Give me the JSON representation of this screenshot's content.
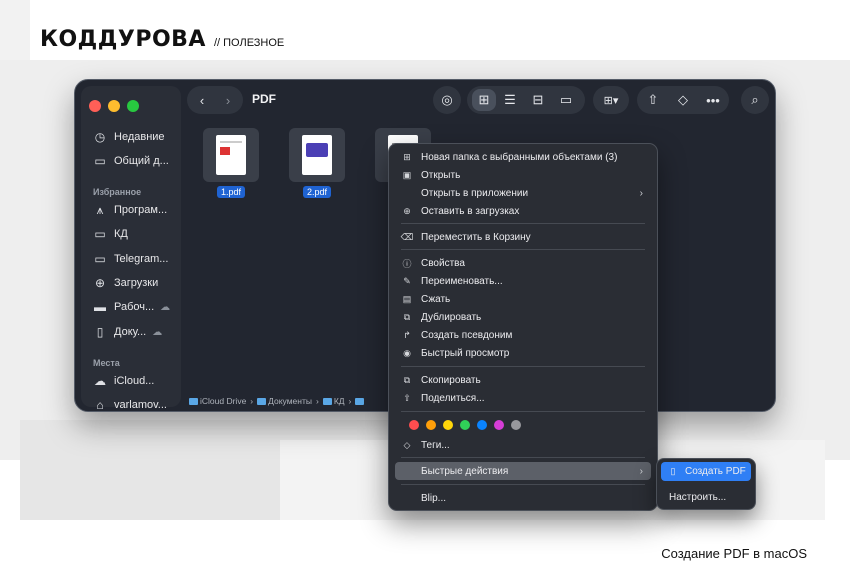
{
  "brand": {
    "logo": "КОДДУРОВА",
    "tag": "// ПОЛЕЗНОЕ"
  },
  "caption": "Создание PDF в macOS",
  "window": {
    "title": "PDF"
  },
  "sidebar": {
    "items_top": [
      {
        "icon": "clock-icon",
        "label": "Недавние"
      },
      {
        "icon": "shared-folder-icon",
        "label": "Общий д..."
      }
    ],
    "favorites_header": "Избранное",
    "favorites": [
      {
        "icon": "applications-icon",
        "label": "Програм..."
      },
      {
        "icon": "folder-icon",
        "label": "КД"
      },
      {
        "icon": "folder-icon",
        "label": "Telegram..."
      },
      {
        "icon": "downloads-icon",
        "label": "Загрузки"
      },
      {
        "icon": "desktop-icon",
        "label": "Рабоч..."
      },
      {
        "icon": "document-icon",
        "label": "Доку..."
      }
    ],
    "places_header": "Места",
    "places": [
      {
        "icon": "icloud-icon",
        "label": "iCloud..."
      },
      {
        "icon": "home-icon",
        "label": "varlamov..."
      }
    ]
  },
  "files": [
    {
      "name": "1.pdf"
    },
    {
      "name": "2.pdf"
    },
    {
      "name": ""
    }
  ],
  "pathbar": [
    "iCloud Drive",
    "Документы",
    "КД"
  ],
  "context_menu": {
    "items": [
      {
        "icon": "new-folder-icon",
        "label": "Новая папка с выбранными объектами (3)"
      },
      {
        "icon": "open-icon",
        "label": "Открыть"
      },
      {
        "icon": "",
        "label": "Открыть в приложении",
        "submenu": "›"
      },
      {
        "icon": "keep-downloaded-icon",
        "label": "Оставить в загрузках"
      },
      {
        "icon": "trash-icon",
        "label": "Переместить в Корзину"
      },
      {
        "icon": "info-icon",
        "label": "Свойства"
      },
      {
        "icon": "pencil-icon",
        "label": "Переименовать..."
      },
      {
        "icon": "archive-icon",
        "label": "Сжать"
      },
      {
        "icon": "duplicate-icon",
        "label": "Дублировать"
      },
      {
        "icon": "alias-icon",
        "label": "Создать псевдоним"
      },
      {
        "icon": "eye-icon",
        "label": "Быстрый просмотр"
      },
      {
        "icon": "copy-icon",
        "label": "Скопировать"
      },
      {
        "icon": "share-icon",
        "label": "Поделиться..."
      },
      {
        "icon": "tag-icon",
        "label": "Теги..."
      },
      {
        "icon": "",
        "label": "Быстрые действия",
        "submenu": "›"
      },
      {
        "icon": "",
        "label": "Blip..."
      }
    ],
    "tag_colors": [
      "#ff4d4f",
      "#ff9f0a",
      "#ffd60a",
      "#30d158",
      "#0a84ff",
      "#d63dd6",
      "#98989d"
    ]
  },
  "submenu": {
    "items": [
      {
        "icon": "document-icon",
        "label": "Создать PDF"
      },
      {
        "icon": "",
        "label": "Настроить..."
      }
    ]
  },
  "colors": {
    "accent": "#2f7ff5",
    "window_bg": "#222630",
    "selection": "#1f63d2"
  }
}
